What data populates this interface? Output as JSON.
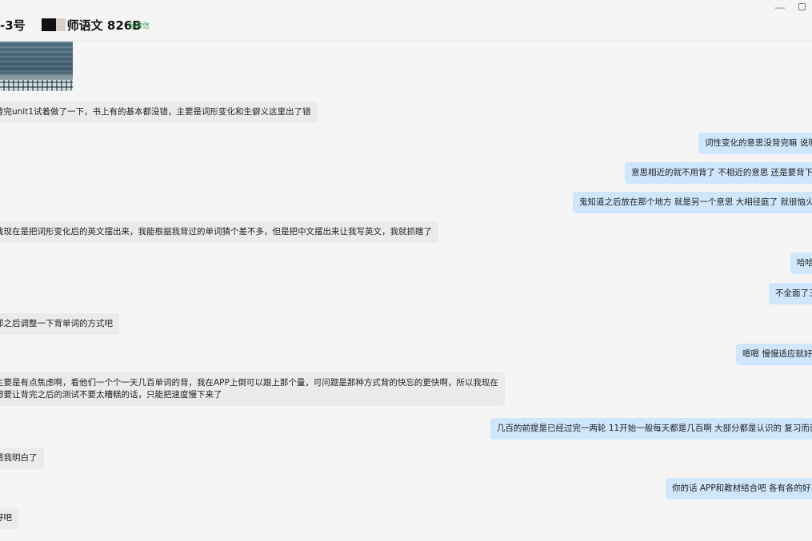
{
  "header": {
    "title_prefix": "-3号",
    "title_main": "师语文 826B",
    "wechat_tag": "@微信",
    "minimize": "—"
  },
  "messages": [
    {
      "side": "in",
      "lines": [
        "背完unit1试着做了一下，书上有的基本都没错，主要是词形变化和生僻义这里出了错"
      ]
    },
    {
      "side": "out",
      "lines": [
        "词性变化的意思没背完嘛 说明"
      ]
    },
    {
      "side": "out",
      "lines": [
        "意思相近的就不用背了  不相近的意思  还是要背下"
      ]
    },
    {
      "side": "out",
      "lines": [
        "鬼知道之后放在那个地方 就是另一个意思  大相径庭了  就很恼火"
      ]
    },
    {
      "side": "in",
      "lines": [
        "我现在是把词形变化后的英文摆出来，我能根据我背过的单词猜个差不多，但是把中文摆出来让我写英文，我就抓瞎了"
      ]
    },
    {
      "side": "out",
      "lines": [
        "哈哈"
      ]
    },
    {
      "side": "out",
      "lines": [
        "不全面了三"
      ]
    },
    {
      "side": "in",
      "lines": [
        "那之后调整一下背单词的方式吧"
      ]
    },
    {
      "side": "out",
      "lines": [
        "嗯嗯  慢慢适应就好"
      ]
    },
    {
      "side": "in",
      "lines": [
        "主要是有点焦虑啊，看他们一个个一天几百单词的背，我在APP上倒可以跟上那个量，可问题是那种方式背的快忘的更快啊，所以我现在",
        "想要让背完之后的测试不要太糟糕的话，只能把速度慢下来了"
      ]
    },
    {
      "side": "out",
      "lines": [
        "几百的前提是已经过完一两轮  11开始一般每天都是几百啊  大部分都是认识的  复习而已"
      ]
    },
    {
      "side": "in",
      "lines": [
        "嗯我明白了"
      ]
    },
    {
      "side": "out",
      "lines": [
        "你的话  APP和教材结合吧  各有各的好"
      ]
    },
    {
      "side": "in",
      "lines": [
        "好吧"
      ]
    }
  ]
}
